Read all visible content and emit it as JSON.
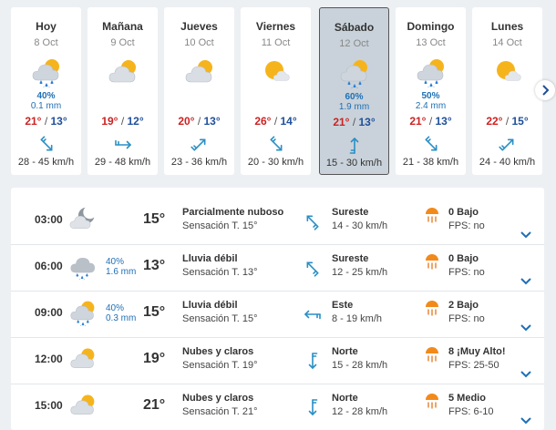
{
  "colors": {
    "max_temp": "#cc2222",
    "min_temp": "#1f4f9a",
    "rain": "#1f6fb5",
    "wind_arrow": "#2a8fc5",
    "selected_bg": "#c9d2da"
  },
  "days": [
    {
      "name": "Hoy",
      "date": "8 Oct",
      "icon": "sun-cloud-rain-icon",
      "prob": "40%",
      "mm": "0.1 mm",
      "max": "21°",
      "min": "13°",
      "wind_icon": "wind-arrow-nw-icon",
      "wind": "28 - 45 km/h",
      "selected": false
    },
    {
      "name": "Mañana",
      "date": "9 Oct",
      "icon": "sun-cloud-icon",
      "prob": "",
      "mm": "",
      "max": "19°",
      "min": "12°",
      "wind_icon": "wind-arrow-w-icon",
      "wind": "29 - 48 km/h",
      "selected": false
    },
    {
      "name": "Jueves",
      "date": "10 Oct",
      "icon": "sun-cloud-icon",
      "prob": "",
      "mm": "",
      "max": "20°",
      "min": "13°",
      "wind_icon": "wind-arrow-sw-icon",
      "wind": "23 - 36 km/h",
      "selected": false
    },
    {
      "name": "Viernes",
      "date": "11 Oct",
      "icon": "sun-small-cloud-icon",
      "prob": "",
      "mm": "",
      "max": "26°",
      "min": "14°",
      "wind_icon": "wind-arrow-nw-icon",
      "wind": "20 - 30 km/h",
      "selected": false
    },
    {
      "name": "Sábado",
      "date": "12 Oct",
      "icon": "sun-cloud-rain-icon",
      "prob": "60%",
      "mm": "1.9 mm",
      "max": "21°",
      "min": "13°",
      "wind_icon": "wind-arrow-s-icon",
      "wind": "15 - 30 km/h",
      "selected": true
    },
    {
      "name": "Domingo",
      "date": "13 Oct",
      "icon": "sun-cloud-rain-icon",
      "prob": "50%",
      "mm": "2.4 mm",
      "max": "21°",
      "min": "13°",
      "wind_icon": "wind-arrow-nw-icon",
      "wind": "21 - 38 km/h",
      "selected": false
    },
    {
      "name": "Lunes",
      "date": "14 Oct",
      "icon": "sun-small-cloud-icon",
      "prob": "",
      "mm": "",
      "max": "22°",
      "min": "15°",
      "wind_icon": "wind-arrow-sw-icon",
      "wind": "24 - 40 km/h",
      "selected": false
    }
  ],
  "next_icon": "chevron-right-icon",
  "hours": [
    {
      "time": "03:00",
      "icon": "moon-cloud-icon",
      "prob": "",
      "mm": "",
      "temp": "15°",
      "desc": "Parcialmente nuboso",
      "feel": "Sensación T. 15°",
      "wind_icon": "wind-arrow-se-icon",
      "dir": "Sureste",
      "speed": "14 - 30 km/h",
      "uv": "0 Bajo",
      "fps": "FPS: no"
    },
    {
      "time": "06:00",
      "icon": "cloud-rain-icon",
      "prob": "40%",
      "mm": "1.6 mm",
      "temp": "13°",
      "desc": "Lluvia débil",
      "feel": "Sensación T. 13°",
      "wind_icon": "wind-arrow-se-icon",
      "dir": "Sureste",
      "speed": "12 - 25 km/h",
      "uv": "0 Bajo",
      "fps": "FPS: no"
    },
    {
      "time": "09:00",
      "icon": "sun-cloud-rain-icon",
      "prob": "40%",
      "mm": "0.3 mm",
      "temp": "15°",
      "desc": "Lluvia débil",
      "feel": "Sensación T. 15°",
      "wind_icon": "wind-arrow-e-icon",
      "dir": "Este",
      "speed": "8 - 19 km/h",
      "uv": "2 Bajo",
      "fps": "FPS: no"
    },
    {
      "time": "12:00",
      "icon": "sun-cloud-icon",
      "prob": "",
      "mm": "",
      "temp": "19°",
      "desc": "Nubes y claros",
      "feel": "Sensación T. 19°",
      "wind_icon": "wind-arrow-n-icon",
      "dir": "Norte",
      "speed": "15 - 28 km/h",
      "uv": "8 ¡Muy Alto!",
      "fps": "FPS: 25-50"
    },
    {
      "time": "15:00",
      "icon": "sun-cloud-icon",
      "prob": "",
      "mm": "",
      "temp": "21°",
      "desc": "Nubes y claros",
      "feel": "Sensación T. 21°",
      "wind_icon": "wind-arrow-n-icon",
      "dir": "Norte",
      "speed": "12 - 28 km/h",
      "uv": "5 Medio",
      "fps": "FPS: 6-10"
    }
  ]
}
